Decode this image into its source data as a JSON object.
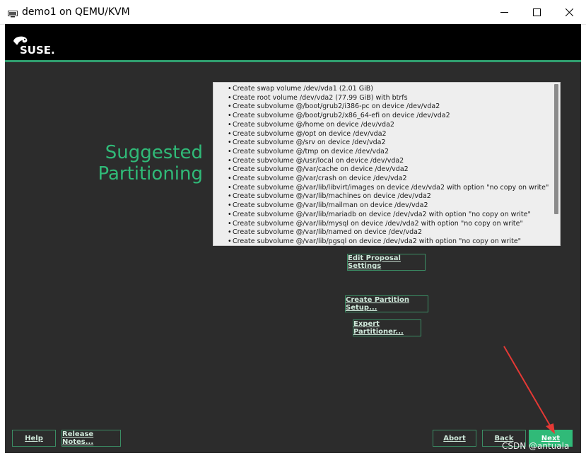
{
  "window": {
    "title": "demo1 on QEMU/KVM",
    "icons": [
      "vm-monitor-icon",
      "minimize-icon",
      "maximize-icon",
      "close-icon"
    ]
  },
  "header": {
    "logo_text": "SUSE."
  },
  "page": {
    "title_line1": "Suggested",
    "title_line2": "Partitioning"
  },
  "proposal": {
    "items": [
      "Create swap volume /dev/vda1 (2.01 GiB)",
      "Create root volume /dev/vda2 (77.99 GiB) with btrfs",
      "Create subvolume @/boot/grub2/i386-pc on device /dev/vda2",
      "Create subvolume @/boot/grub2/x86_64-efi on device /dev/vda2",
      "Create subvolume @/home on device /dev/vda2",
      "Create subvolume @/opt on device /dev/vda2",
      "Create subvolume @/srv on device /dev/vda2",
      "Create subvolume @/tmp on device /dev/vda2",
      "Create subvolume @/usr/local on device /dev/vda2",
      "Create subvolume @/var/cache on device /dev/vda2",
      "Create subvolume @/var/crash on device /dev/vda2",
      "Create subvolume @/var/lib/libvirt/images on device /dev/vda2 with option \"no copy on write\"",
      "Create subvolume @/var/lib/machines on device /dev/vda2",
      "Create subvolume @/var/lib/mailman on device /dev/vda2",
      "Create subvolume @/var/lib/mariadb on device /dev/vda2 with option \"no copy on write\"",
      "Create subvolume @/var/lib/mysql on device /dev/vda2 with option \"no copy on write\"",
      "Create subvolume @/var/lib/named on device /dev/vda2",
      "Create subvolume @/var/lib/pgsql on device /dev/vda2 with option \"no copy on write\""
    ]
  },
  "buttons": {
    "edit_proposal": "Edit Proposal Settings",
    "create_partition": "Create Partition Setup...",
    "expert_partitioner": "Expert Partitioner...",
    "help": "Help",
    "release_notes": "Release Notes...",
    "abort": "Abort",
    "back": "Back",
    "next": "Next"
  },
  "watermark": "CSDN @antuala",
  "colors": {
    "accent": "#30ba78",
    "screen_bg": "#2c2c2c",
    "arrow": "#e53935"
  }
}
